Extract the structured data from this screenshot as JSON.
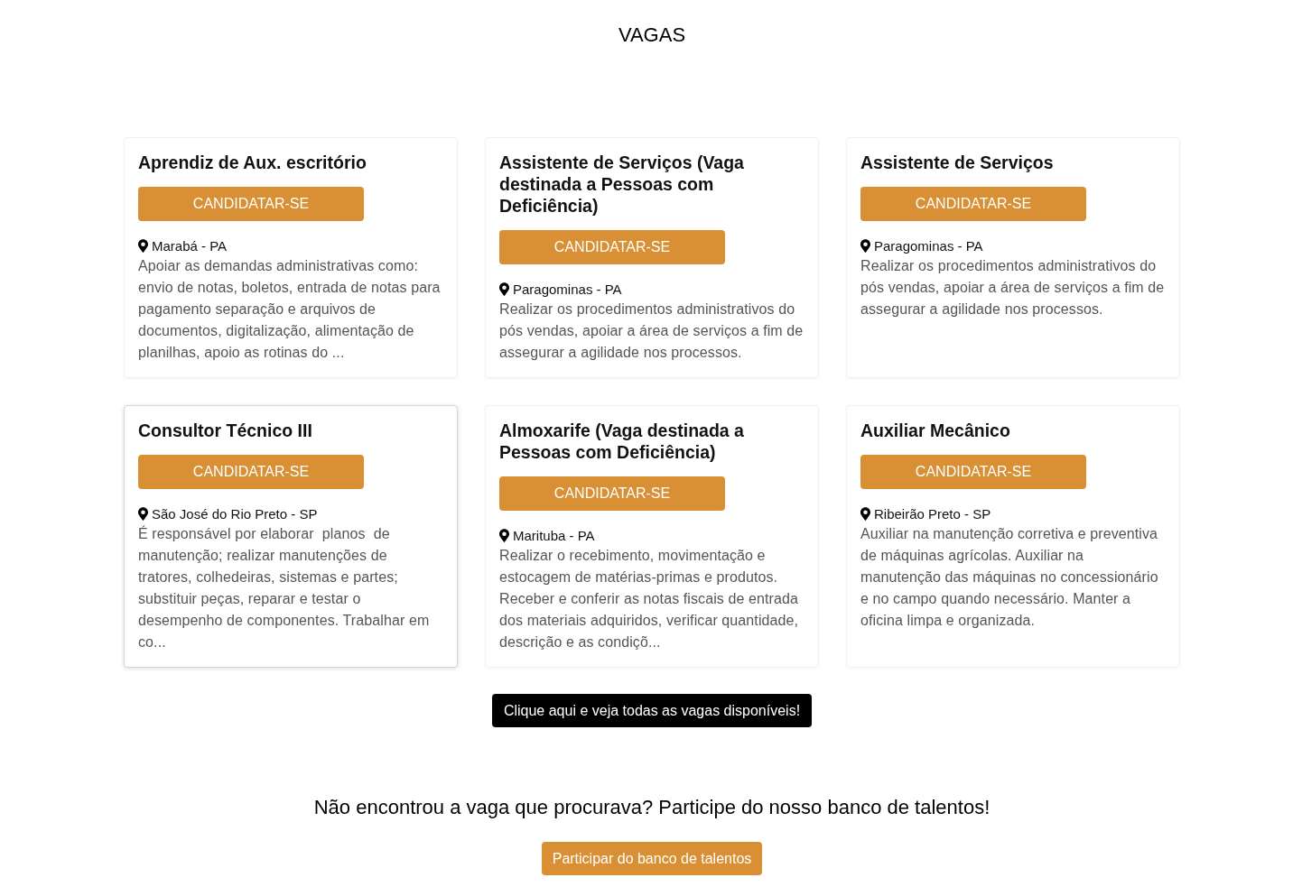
{
  "page_title": "VAGAS",
  "jobs": [
    {
      "title": "Aprendiz de Aux. escritório",
      "apply_button": "CANDIDATAR-SE",
      "location": "Marabá - PA",
      "description": "Apoiar as demandas administrativas como: envio de notas, boletos, entrada de notas para pagamento separação e arquivos de documentos, digitalização, alimentação de planilhas, apoio as rotinas do ...",
      "hovered": false
    },
    {
      "title": "Assistente de Serviços (Vaga destinada a Pessoas com Deficiência)",
      "apply_button": "CANDIDATAR-SE",
      "location": "Paragominas - PA",
      "description": "Realizar os procedimentos administrativos do pós vendas, apoiar a área de serviços a fim de assegurar a agilidade nos processos.",
      "hovered": false
    },
    {
      "title": "Assistente de Serviços",
      "apply_button": "CANDIDATAR-SE",
      "location": "Paragominas - PA",
      "description": "Realizar os procedimentos administrativos do pós vendas, apoiar a área de serviços a fim de assegurar a agilidade nos processos.",
      "hovered": false
    },
    {
      "title": "Consultor Técnico III",
      "apply_button": "CANDIDATAR-SE",
      "location": "São José do Rio Preto - SP",
      "description": "É responsável por elaborar  planos  de manutenção; realizar manutenções de tratores, colhedeiras, sistemas e partes; substituir peças, reparar e testar o desempenho de componentes. Trabalhar em co...",
      "hovered": true
    },
    {
      "title": "Almoxarife (Vaga destinada a Pessoas com Deficiência)",
      "apply_button": "CANDIDATAR-SE",
      "location": "Marituba - PA",
      "description": "Realizar o recebimento, movimentação e estocagem de matérias-primas e produtos. Receber e conferir as notas fiscais de entrada dos materiais adquiridos, verificar quantidade, descrição e as condiçõ...",
      "hovered": false
    },
    {
      "title": "Auxiliar Mecânico",
      "apply_button": "CANDIDATAR-SE",
      "location": "Ribeirão Preto - SP",
      "description": "Auxiliar na manutenção corretiva e preventiva de máquinas agrícolas. Auxiliar na manutenção das máquinas no concessionário e no campo quando necessário. Manter a oficina limpa e organizada.",
      "hovered": false
    }
  ],
  "all_jobs_button": "Clique aqui e veja todas as vagas disponíveis!",
  "talent_pool": {
    "prompt": "Não encontrou a vaga que procurava? Participe do nosso banco de talentos!",
    "button": "Participar do banco de talentos"
  }
}
